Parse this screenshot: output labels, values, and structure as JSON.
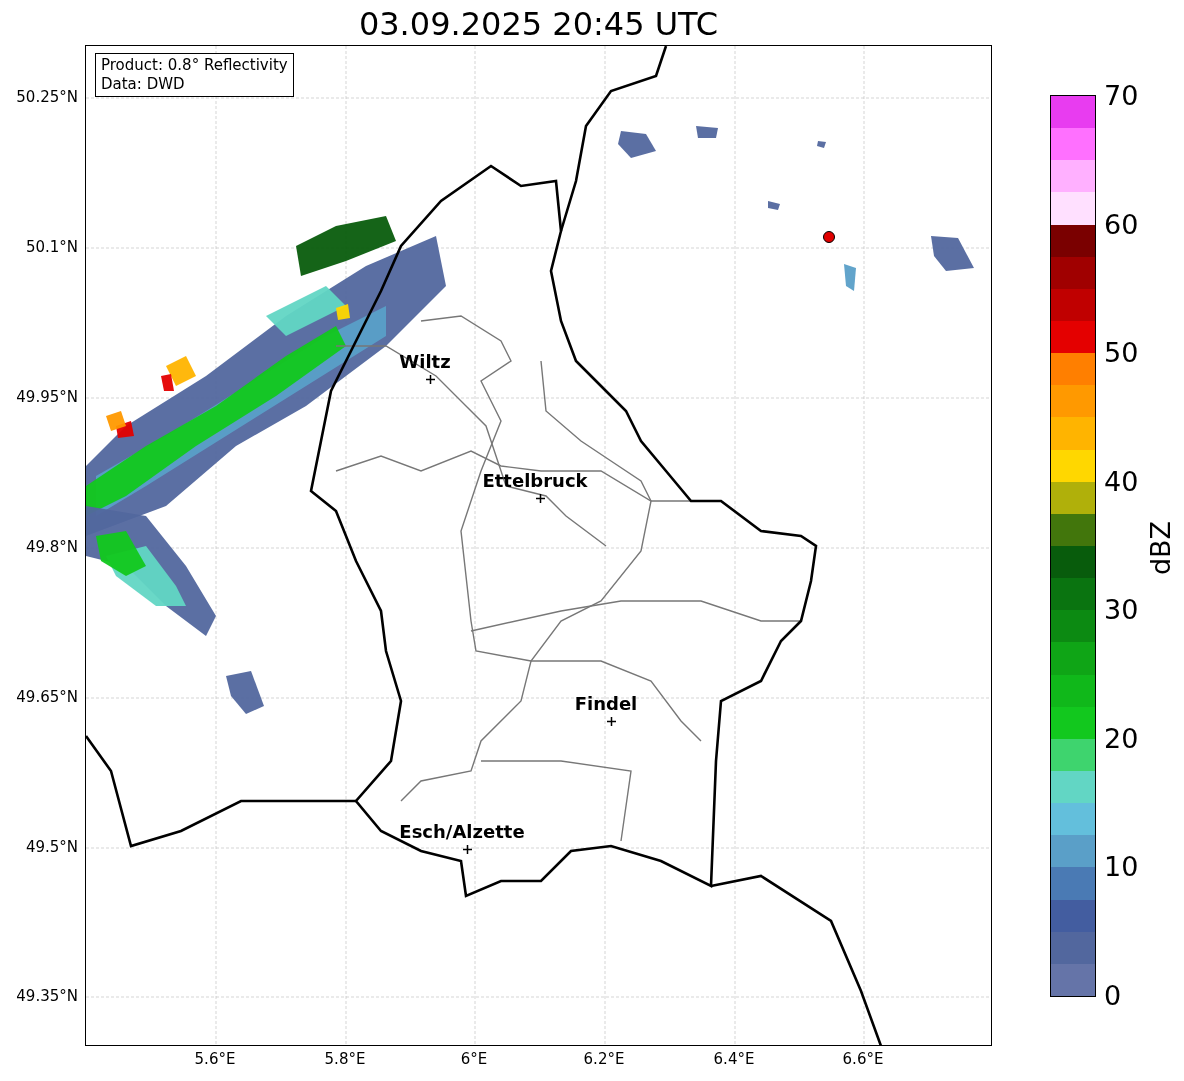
{
  "title": "03.09.2025 20:45 UTC",
  "info_box": [
    "Product: 0.8° Reflectivity",
    "Data: DWD"
  ],
  "y_axis_labels": [
    "50.25°N",
    "50.1°N",
    "49.95°N",
    "49.8°N",
    "49.65°N",
    "49.5°N",
    "49.35°N"
  ],
  "x_axis_labels": [
    "5.6°E",
    "5.8°E",
    "6°E",
    "6.2°E",
    "6.4°E",
    "6.6°E"
  ],
  "cities": [
    {
      "name": "Wiltz"
    },
    {
      "name": "Ettelbruck"
    },
    {
      "name": "Findel"
    },
    {
      "name": "Esch/Alzette"
    }
  ],
  "colorbar": {
    "label": "dBZ",
    "ticks": [
      "70",
      "60",
      "50",
      "40",
      "30",
      "20",
      "10",
      "0"
    ],
    "bands": [
      {
        "color": "#e83cf0"
      },
      {
        "color": "#ff70ff"
      },
      {
        "color": "#ffb0ff"
      },
      {
        "color": "#ffe0ff"
      },
      {
        "color": "#7a0000"
      },
      {
        "color": "#a00000"
      },
      {
        "color": "#c00000"
      },
      {
        "color": "#e40000"
      },
      {
        "color": "#ff7f00"
      },
      {
        "color": "#ff9900"
      },
      {
        "color": "#ffb400"
      },
      {
        "color": "#ffd700"
      },
      {
        "color": "#b0b00a"
      },
      {
        "color": "#42760c"
      },
      {
        "color": "#085c0c"
      },
      {
        "color": "#0a7410"
      },
      {
        "color": "#0c8a12"
      },
      {
        "color": "#0fa516"
      },
      {
        "color": "#10b81a"
      },
      {
        "color": "#12c81e"
      },
      {
        "color": "#3ed46e"
      },
      {
        "color": "#62d6c4"
      },
      {
        "color": "#63bfdc"
      },
      {
        "color": "#5a9fc8"
      },
      {
        "color": "#4a7ab4"
      },
      {
        "color": "#435da0"
      },
      {
        "color": "#52679e"
      },
      {
        "color": "#6574a8"
      }
    ]
  }
}
